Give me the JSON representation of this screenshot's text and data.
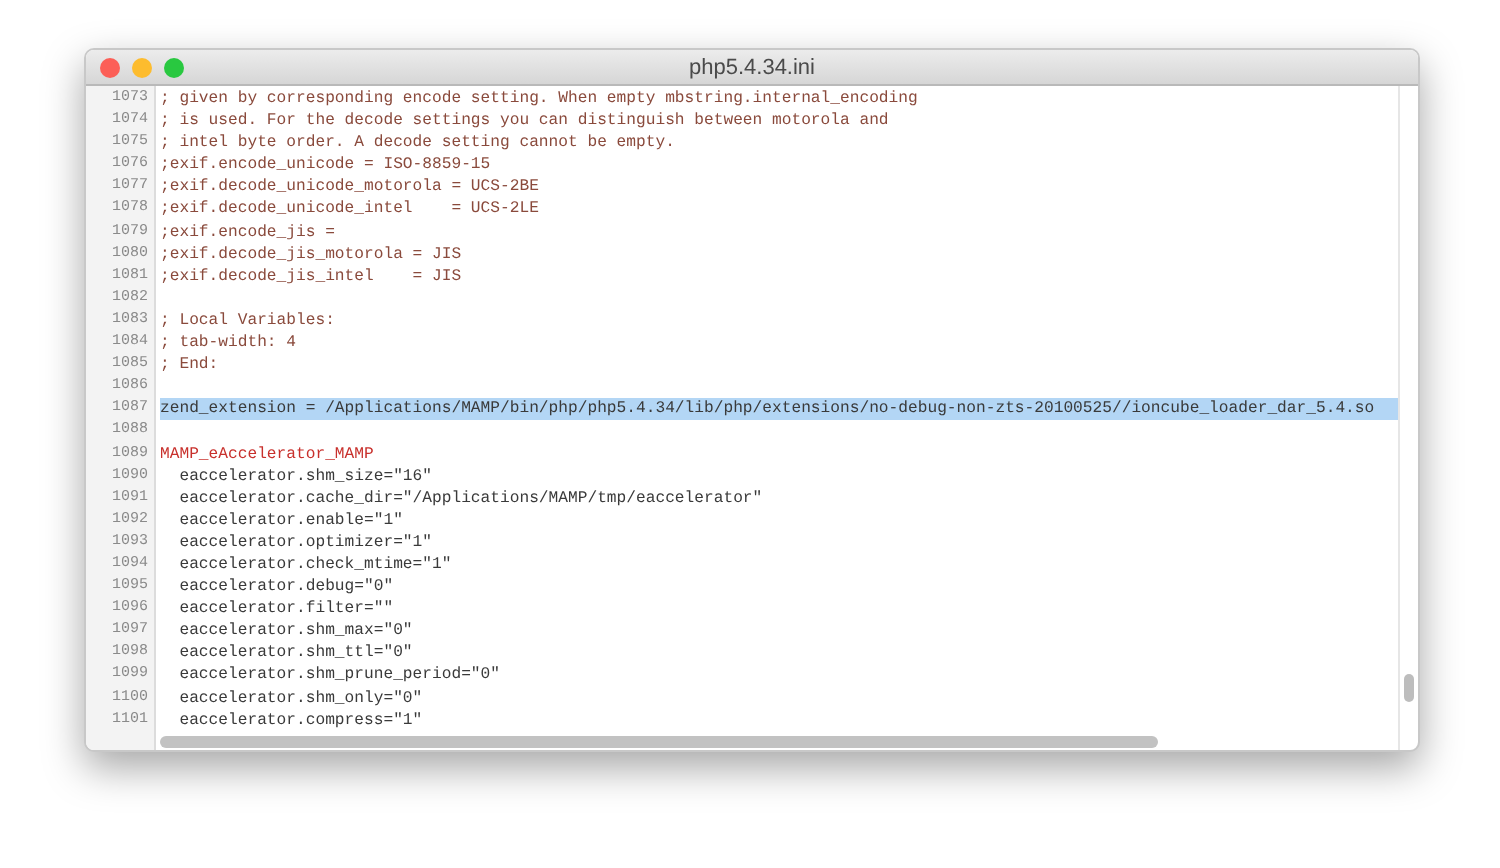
{
  "window": {
    "title": "php5.4.34.ini"
  },
  "lines": [
    {
      "number": "1073",
      "kind": "comment",
      "selected": false,
      "text": "; given by corresponding encode setting. When empty mbstring.internal_encoding"
    },
    {
      "number": "1074",
      "kind": "comment",
      "selected": false,
      "text": "; is used. For the decode settings you can distinguish between motorola and"
    },
    {
      "number": "1075",
      "kind": "comment",
      "selected": false,
      "text": "; intel byte order. A decode setting cannot be empty."
    },
    {
      "number": "1076",
      "kind": "comment",
      "selected": false,
      "text": ";exif.encode_unicode = ISO-8859-15"
    },
    {
      "number": "1077",
      "kind": "comment",
      "selected": false,
      "text": ";exif.decode_unicode_motorola = UCS-2BE"
    },
    {
      "number": "1078",
      "kind": "comment",
      "selected": false,
      "text": ";exif.decode_unicode_intel    = UCS-2LE"
    },
    {
      "number": "1079",
      "kind": "comment",
      "selected": false,
      "text": ";exif.encode_jis ="
    },
    {
      "number": "1080",
      "kind": "comment",
      "selected": false,
      "text": ";exif.decode_jis_motorola = JIS"
    },
    {
      "number": "1081",
      "kind": "comment",
      "selected": false,
      "text": ";exif.decode_jis_intel    = JIS"
    },
    {
      "number": "1082",
      "kind": "blank",
      "selected": false
    },
    {
      "number": "1083",
      "kind": "comment",
      "selected": false,
      "text": "; Local Variables:"
    },
    {
      "number": "1084",
      "kind": "comment",
      "selected": false,
      "text": "; tab-width: 4"
    },
    {
      "number": "1085",
      "kind": "comment",
      "selected": false,
      "text": "; End:"
    },
    {
      "number": "1086",
      "kind": "blank",
      "selected": false
    },
    {
      "number": "1087",
      "kind": "code",
      "selected": true,
      "text": "zend_extension = /Applications/MAMP/bin/php/php5.4.34/lib/php/extensions/no-debug-non-zts-20100525//ioncube_loader_dar_5.4.so"
    },
    {
      "number": "1088",
      "kind": "blank",
      "selected": false
    },
    {
      "number": "1089",
      "kind": "section",
      "selected": false,
      "text": "MAMP_eAccelerator_MAMP"
    },
    {
      "number": "1090",
      "kind": "code",
      "selected": false,
      "text": "  eaccelerator.shm_size=\"16\""
    },
    {
      "number": "1091",
      "kind": "code",
      "selected": false,
      "text": "  eaccelerator.cache_dir=\"/Applications/MAMP/tmp/eaccelerator\""
    },
    {
      "number": "1092",
      "kind": "code",
      "selected": false,
      "text": "  eaccelerator.enable=\"1\""
    },
    {
      "number": "1093",
      "kind": "code",
      "selected": false,
      "text": "  eaccelerator.optimizer=\"1\""
    },
    {
      "number": "1094",
      "kind": "code",
      "selected": false,
      "text": "  eaccelerator.check_mtime=\"1\""
    },
    {
      "number": "1095",
      "kind": "code",
      "selected": false,
      "text": "  eaccelerator.debug=\"0\""
    },
    {
      "number": "1096",
      "kind": "code",
      "selected": false,
      "text": "  eaccelerator.filter=\"\""
    },
    {
      "number": "1097",
      "kind": "code",
      "selected": false,
      "text": "  eaccelerator.shm_max=\"0\""
    },
    {
      "number": "1098",
      "kind": "code",
      "selected": false,
      "text": "  eaccelerator.shm_ttl=\"0\""
    },
    {
      "number": "1099",
      "kind": "code",
      "selected": false,
      "text": "  eaccelerator.shm_prune_period=\"0\""
    },
    {
      "number": "1100",
      "kind": "code",
      "selected": false,
      "text": "  eaccelerator.shm_only=\"0\""
    },
    {
      "number": "1101",
      "kind": "code",
      "selected": false,
      "text": "  eaccelerator.compress=\"1\""
    }
  ]
}
